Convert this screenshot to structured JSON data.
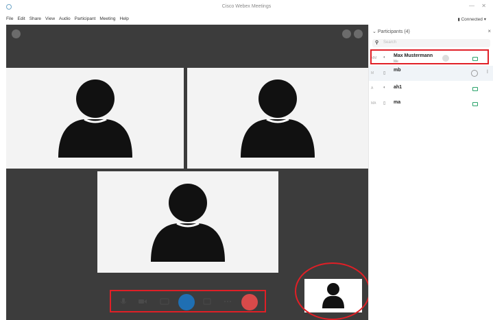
{
  "window": {
    "title": "Cisco Webex Meetings",
    "min_icon": "—",
    "close_icon": "✕"
  },
  "menu": {
    "file": "File",
    "edit": "Edit",
    "share": "Share",
    "view": "View",
    "audio": "Audio",
    "participant": "Participant",
    "meeting": "Meeting",
    "help": "Help"
  },
  "status": {
    "connected": "Connected"
  },
  "panel": {
    "title": "Participants (4)",
    "search_placeholder": "Search",
    "participants": [
      {
        "initials": "MM",
        "name": "Max Mustermann",
        "sub": "Me"
      },
      {
        "initials": "M",
        "name": "mb",
        "sub": ""
      },
      {
        "initials": "A",
        "name": "ah1",
        "sub": ""
      },
      {
        "initials": "MA",
        "name": "ma",
        "sub": ""
      }
    ]
  },
  "toolbar": {
    "mute_icon": "microphone-icon",
    "video_icon": "video-icon",
    "share_icon": "share-icon",
    "record_icon": "record-icon",
    "participants_icon": "participants-icon",
    "more_icon": "more-icon",
    "leave_icon": "leave-icon"
  },
  "colors": {
    "accent_red": "#e01f26",
    "stage_bg": "#3c3c3c",
    "webex_blue": "#1f6fb3",
    "cam_green": "#2aa36b"
  }
}
